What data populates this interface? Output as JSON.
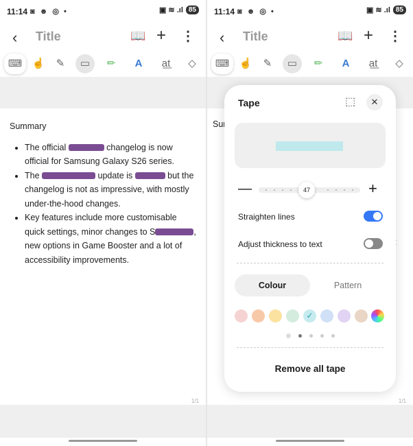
{
  "status": {
    "time": "11:14",
    "battery": "85",
    "left_icons": "◙ ☻ ◎ •",
    "right_icons": "▣ ≋ .ıl"
  },
  "appbar": {
    "title": "Title"
  },
  "note": {
    "heading": "Summary",
    "bullets": [
      {
        "a": "The official ",
        "b": " changelog is now official for Samsung Galaxy S26 series."
      },
      {
        "a": "The ",
        "b": " update is ",
        "c": " but the changelog is not as impressive, with mostly under-the-hood changes."
      },
      {
        "a": "Key features include more customisable quick settings, minor changes to S",
        "b": ", new options in Game Booster and a lot of accessibility improvements."
      }
    ],
    "page_number": "1/1"
  },
  "right_fragments": {
    "sum": "Sur",
    "t": "t"
  },
  "tape_sheet": {
    "title": "Tape",
    "thickness": "47",
    "straighten_label": "Straighten lines",
    "straighten_on": true,
    "adjust_label": "Adjust thickness to text",
    "adjust_on": false,
    "tab_colour": "Colour",
    "tab_pattern": "Pattern",
    "swatches": [
      "#f6d3d3",
      "#f7c9a8",
      "#fbe2a0",
      "#d4ecdd",
      "#c6ebef",
      "#cfe0f7",
      "#e0d3f3",
      "#ead6c6"
    ],
    "selected_swatch": 4,
    "remove_label": "Remove all tape"
  },
  "colors": {
    "accent": "#3478f6",
    "tape": "#6b3a87",
    "preview_tape": "#bfe9ec"
  }
}
